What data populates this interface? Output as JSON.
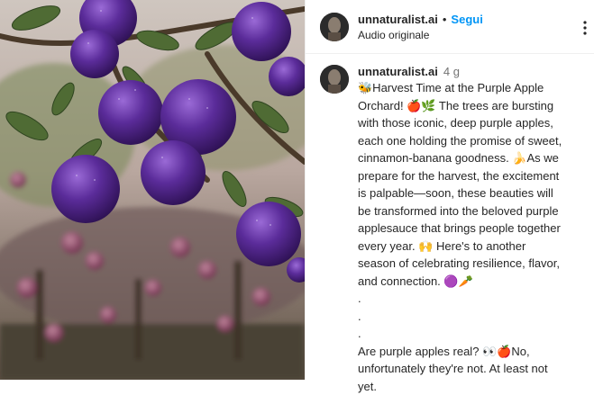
{
  "post": {
    "header": {
      "username": "unnaturalist.ai",
      "separator": "•",
      "follow_label": "Segui",
      "audio_label": "Audio originale"
    },
    "comment": {
      "username": "unnaturalist.ai",
      "time": "4 g",
      "caption_lines": [
        "🐝Harvest Time at the Purple Apple",
        "Orchard! 🍎🌿 The trees are bursting",
        "with those iconic, deep purple apples,",
        "each one holding the promise of sweet,",
        "cinnamon-banana goodness. 🍌As we",
        "prepare for the harvest, the excitement",
        "is palpable—soon, these beauties will",
        "be transformed into the beloved purple",
        "applesauce that brings people together",
        "every year. 🙌 Here's to another",
        "season of celebrating resilience, flavor,",
        "and connection. 🟣🥕",
        ".",
        ".",
        ".",
        "Are purple apples real? 👀🍎No,",
        "unfortunately they're not. At least not",
        "yet."
      ]
    },
    "icons": {
      "more": "more-options-icon",
      "avatar": "profile-avatar"
    },
    "colors": {
      "follow": "#0095f6",
      "text": "#262626",
      "muted": "#737373",
      "apple": "#5a2a8a"
    }
  }
}
